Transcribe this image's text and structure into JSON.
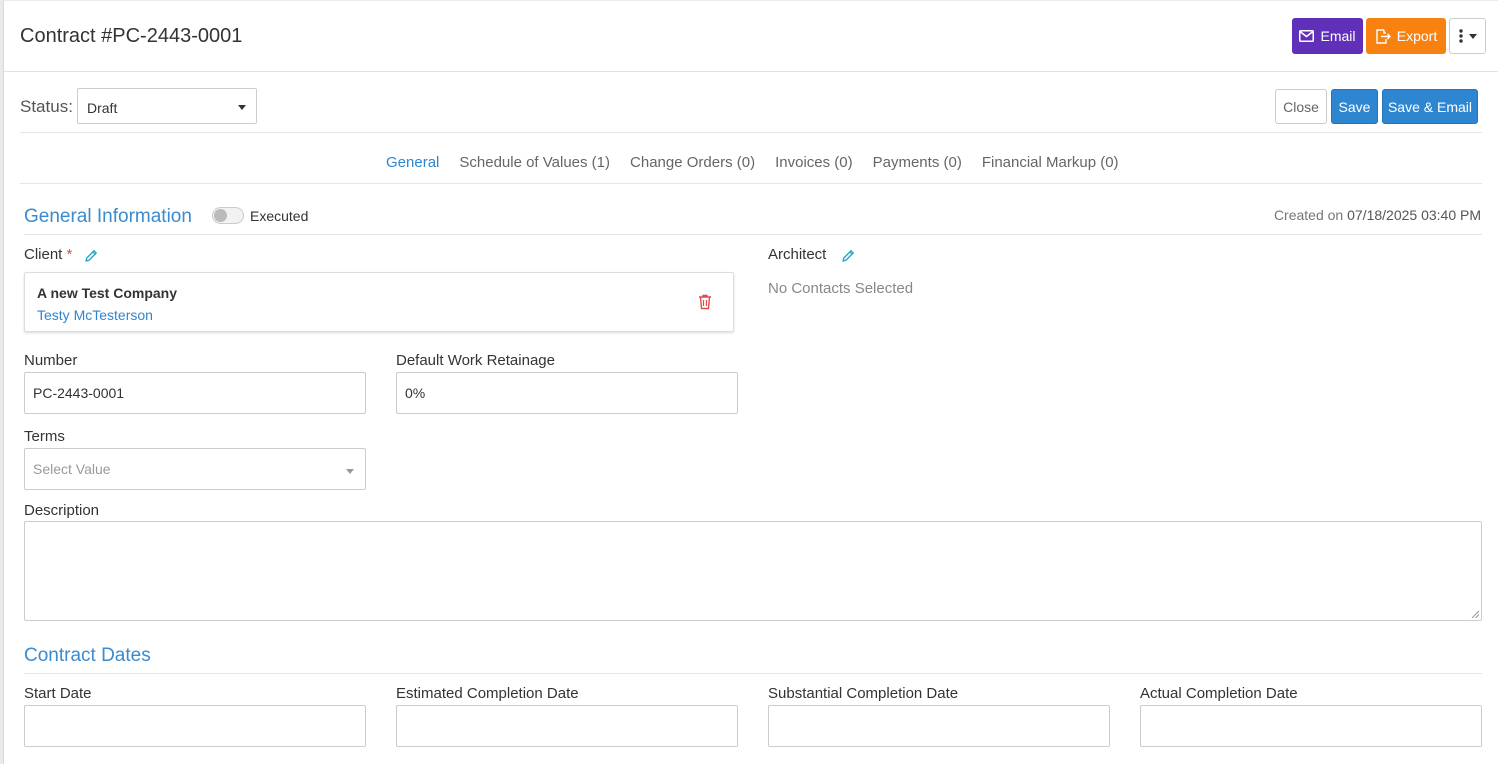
{
  "header": {
    "title": "Contract #PC-2443-0001",
    "email_label": "Email",
    "export_label": "Export"
  },
  "toolbar": {
    "status_label": "Status:",
    "status_value": "Draft",
    "close_label": "Close",
    "save_label": "Save",
    "save_email_label": "Save & Email"
  },
  "tabs": [
    {
      "label": "General",
      "active": true
    },
    {
      "label": "Schedule of Values (1)"
    },
    {
      "label": "Change Orders (0)"
    },
    {
      "label": "Invoices (0)"
    },
    {
      "label": "Payments (0)"
    },
    {
      "label": "Financial Markup (0)"
    }
  ],
  "general": {
    "section_title": "General Information",
    "executed_label": "Executed",
    "executed_on": false,
    "created_prefix": "Created on",
    "created_value": "07/18/2025 03:40 PM",
    "client_label": "Client",
    "required_mark": "*",
    "client_company": "A new Test Company",
    "client_contact": "Testy McTesterson",
    "architect_label": "Architect",
    "architect_empty": "No Contacts Selected",
    "number_label": "Number",
    "number_value": "PC-2443-0001",
    "retainage_label": "Default Work Retainage",
    "retainage_value": "0%",
    "terms_label": "Terms",
    "terms_placeholder": "Select Value",
    "description_label": "Description"
  },
  "dates": {
    "section_title": "Contract Dates",
    "start_label": "Start Date",
    "estimated_label": "Estimated Completion Date",
    "substantial_label": "Substantial Completion Date",
    "actual_label": "Actual Completion Date"
  },
  "colors": {
    "email_button": "#6130b8",
    "export_button": "#f7820f",
    "primary": "#2f86d0",
    "required": "#e04b4b"
  }
}
